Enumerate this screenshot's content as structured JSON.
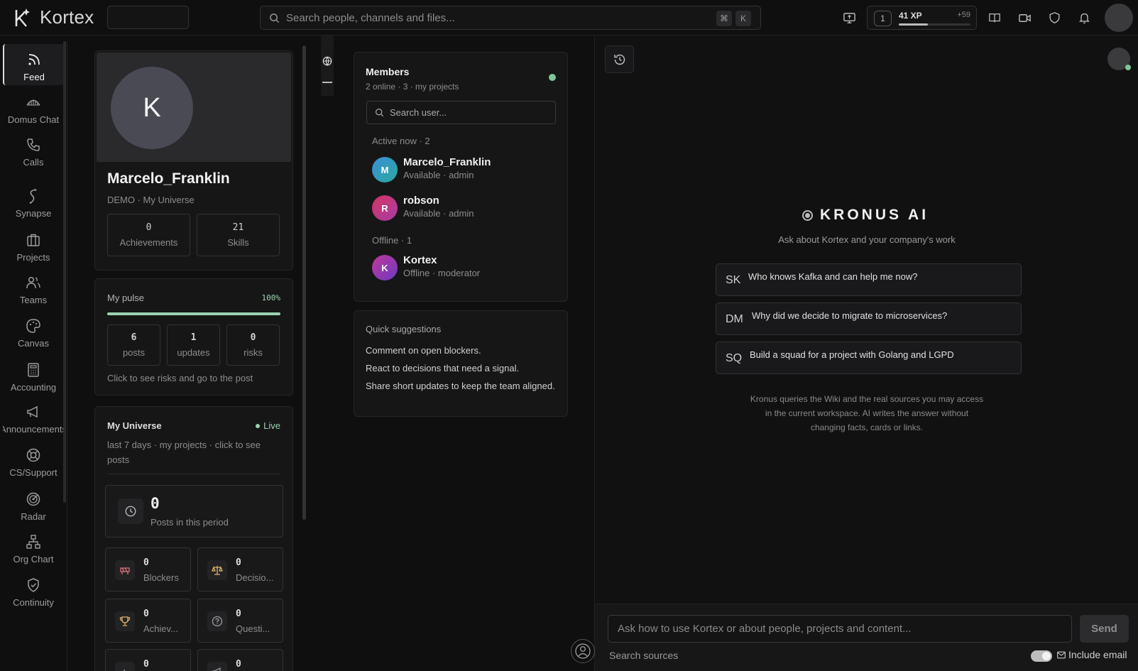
{
  "app": {
    "name": "Kortex"
  },
  "search": {
    "placeholder": "Search people, channels and files...",
    "kbd_cmd": "⌘",
    "kbd_key": "K"
  },
  "xp": {
    "level": "1",
    "value": "41 XP",
    "gain": "+59",
    "progress": 0.41
  },
  "sidebar": {
    "items": [
      {
        "label": "Feed",
        "icon": "rss-icon"
      },
      {
        "label": "Domus Chat",
        "icon": "domus-icon"
      },
      {
        "label": "Calls",
        "icon": "phone-icon"
      },
      {
        "label": "Synapse",
        "icon": "synapse-icon"
      },
      {
        "label": "Projects",
        "icon": "briefcase-icon"
      },
      {
        "label": "Teams",
        "icon": "users-icon"
      },
      {
        "label": "Canvas",
        "icon": "palette-icon"
      },
      {
        "label": "Accounting",
        "icon": "calculator-icon"
      },
      {
        "label": "Announcements",
        "icon": "megaphone-icon"
      },
      {
        "label": "CS/Support",
        "icon": "lifebuoy-icon"
      },
      {
        "label": "Radar",
        "icon": "radar-icon"
      },
      {
        "label": "Org Chart",
        "icon": "orgchart-icon"
      },
      {
        "label": "Continuity",
        "icon": "shield-check-icon"
      }
    ],
    "collapse": "‹"
  },
  "profile": {
    "initial": "K",
    "name": "Marcelo_Franklin",
    "subtitle": "DEMO · My Universe",
    "achievements_value": "0",
    "achievements_label": "Achievements",
    "skills_value": "21",
    "skills_label": "Skills"
  },
  "pulse": {
    "title": "My pulse",
    "percent_label": "100%",
    "percent": 100,
    "posts_value": "6",
    "posts_label": "posts",
    "updates_value": "1",
    "updates_label": "updates",
    "risks_value": "0",
    "risks_label": "risks",
    "hint": "Click to see risks and go to the post"
  },
  "universe": {
    "title": "My Universe",
    "live": "Live",
    "desc": "last 7 days · my projects · click to see posts",
    "posts_value": "0",
    "posts_label": "Posts in this period",
    "tiles": [
      {
        "value": "0",
        "label": "Blockers",
        "icon": "blocker-icon",
        "color": "#e0707a"
      },
      {
        "value": "0",
        "label": "Decisio...",
        "icon": "scale-icon",
        "color": "#e0b36a"
      },
      {
        "value": "0",
        "label": "Achiev...",
        "icon": "trophy-icon",
        "color": "#e0b36a"
      },
      {
        "value": "0",
        "label": "Questi...",
        "icon": "question-icon",
        "color": "#9a9a9a"
      },
      {
        "value": "0",
        "label": "",
        "icon": "bar-chart-icon",
        "color": "#9a9a9a"
      },
      {
        "value": "0",
        "label": "",
        "icon": "megaphone-icon",
        "color": "#9a9a9a"
      }
    ]
  },
  "members": {
    "title": "Members",
    "subtitle": "2 online · 3 · my projects",
    "search_placeholder": "Search user...",
    "active_label": "Active now · 2",
    "offline_label": "Offline · 1",
    "list": [
      {
        "initial": "M",
        "name": "Marcelo_Franklin",
        "status": "Available · admin",
        "color": "#3b8fd6"
      },
      {
        "initial": "R",
        "name": "robson",
        "status": "Available · admin",
        "color": "#c23a78"
      },
      {
        "initial": "K",
        "name": "Kortex",
        "status": "Offline · moderator",
        "color": "#9a3bb8"
      }
    ]
  },
  "suggestions": {
    "title": "Quick suggestions",
    "items": [
      "Comment on open blockers.",
      "React to decisions that need a signal.",
      "Share short updates to keep the team aligned."
    ]
  },
  "kronus": {
    "title": "KRONUS AI",
    "subtitle": "Ask about Kortex and your company's work",
    "prompts": [
      {
        "code": "SK",
        "text": "Who knows Kafka and can help me now?"
      },
      {
        "code": "DM",
        "text": "Why did we decide to migrate to microservices?"
      },
      {
        "code": "SQ",
        "text": "Build a squad for a project with Golang and LGPD"
      }
    ],
    "note": "Kronus queries the Wiki and the real sources you may access in the current workspace. AI writes the answer without changing facts, cards or links.",
    "input_placeholder": "Ask how to use Kortex or about people, projects and content...",
    "send": "Send",
    "search_sources": "Search sources",
    "include_email": "Include email",
    "include_email_on": true
  }
}
